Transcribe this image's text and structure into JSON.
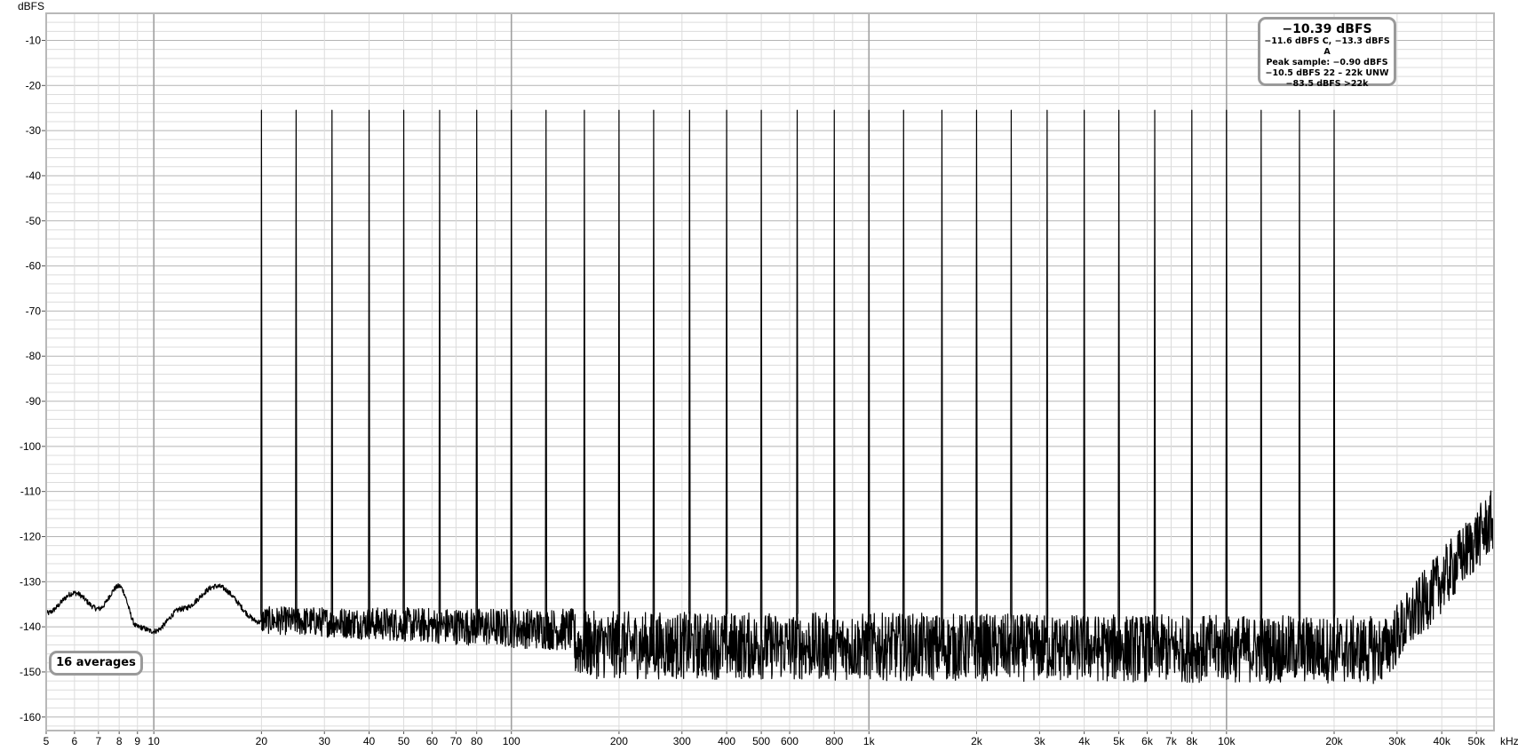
{
  "chart_data": {
    "type": "line",
    "title": "",
    "xlabel": "",
    "ylabel": "dBFS",
    "x_unit_label": "kHz",
    "x_scale": "log",
    "xlim": [
      5,
      56000
    ],
    "ylim": [
      -163,
      -4
    ],
    "grid": true,
    "y_ticks": [
      -10,
      -20,
      -30,
      -40,
      -50,
      -60,
      -70,
      -80,
      -90,
      -100,
      -110,
      -120,
      -130,
      -140,
      -150,
      -160
    ],
    "y_tick_labels": [
      "-10",
      "-20",
      "-30",
      "-40",
      "-50",
      "-60",
      "-70",
      "-80",
      "-90",
      "-100",
      "-110",
      "-120",
      "-130",
      "-140",
      "-150",
      "-160"
    ],
    "x_ticks": [
      5,
      6,
      7,
      8,
      9,
      10,
      20,
      30,
      40,
      50,
      60,
      70,
      80,
      100,
      200,
      300,
      400,
      500,
      600,
      800,
      1000,
      2000,
      3000,
      4000,
      5000,
      6000,
      7000,
      8000,
      10000,
      20000,
      30000,
      40000,
      50000
    ],
    "x_tick_labels": [
      "5",
      "6",
      "7",
      "8",
      "9",
      "10",
      "20",
      "30",
      "40",
      "50",
      "60",
      "70",
      "80",
      "100",
      "200",
      "300",
      "400",
      "500",
      "600",
      "800",
      "1k",
      "2k",
      "3k",
      "4k",
      "5k",
      "6k",
      "7k",
      "8k",
      "10k",
      "20k",
      "30k",
      "40k",
      "50k"
    ],
    "series": [
      {
        "color": "#000000",
        "tones_hz": [
          20,
          25,
          31.5,
          40,
          50,
          63,
          80,
          100,
          125,
          160,
          200,
          250,
          315,
          400,
          500,
          630,
          800,
          1000,
          1250,
          1600,
          2000,
          2500,
          3150,
          4000,
          5000,
          6300,
          8000,
          10000,
          12500,
          16000,
          20000
        ],
        "tone_level_dbfs": -25.5,
        "noise_floor_low_hz": [
          [
            5,
            -137
          ],
          [
            6,
            -132.5
          ],
          [
            7,
            -136
          ],
          [
            8,
            -131
          ],
          [
            9,
            -140
          ],
          [
            10,
            -141
          ],
          [
            12,
            -136
          ],
          [
            15,
            -131
          ],
          [
            20,
            -139
          ]
        ],
        "noise_floor_mean_dbfs": -143,
        "noise_rise_start_hz": 27000,
        "noise_rise_top_dbfs": -122
      }
    ]
  },
  "stats_box": {
    "main": "−10.39 dBFS",
    "line1": "−11.6 dBFS C, −13.3 dBFS A",
    "line2": "Peak sample: −0.90 dBFS",
    "line3": "−10.5 dBFS 22 – 22k UNW",
    "line4": "−83.5 dBFS >22k"
  },
  "averages_label": "16 averages",
  "colors": {
    "grid_minor": "#dcdcdc",
    "grid_major": "#b4b4b4",
    "trace": "#000000",
    "frame": "#b8b8b8"
  }
}
